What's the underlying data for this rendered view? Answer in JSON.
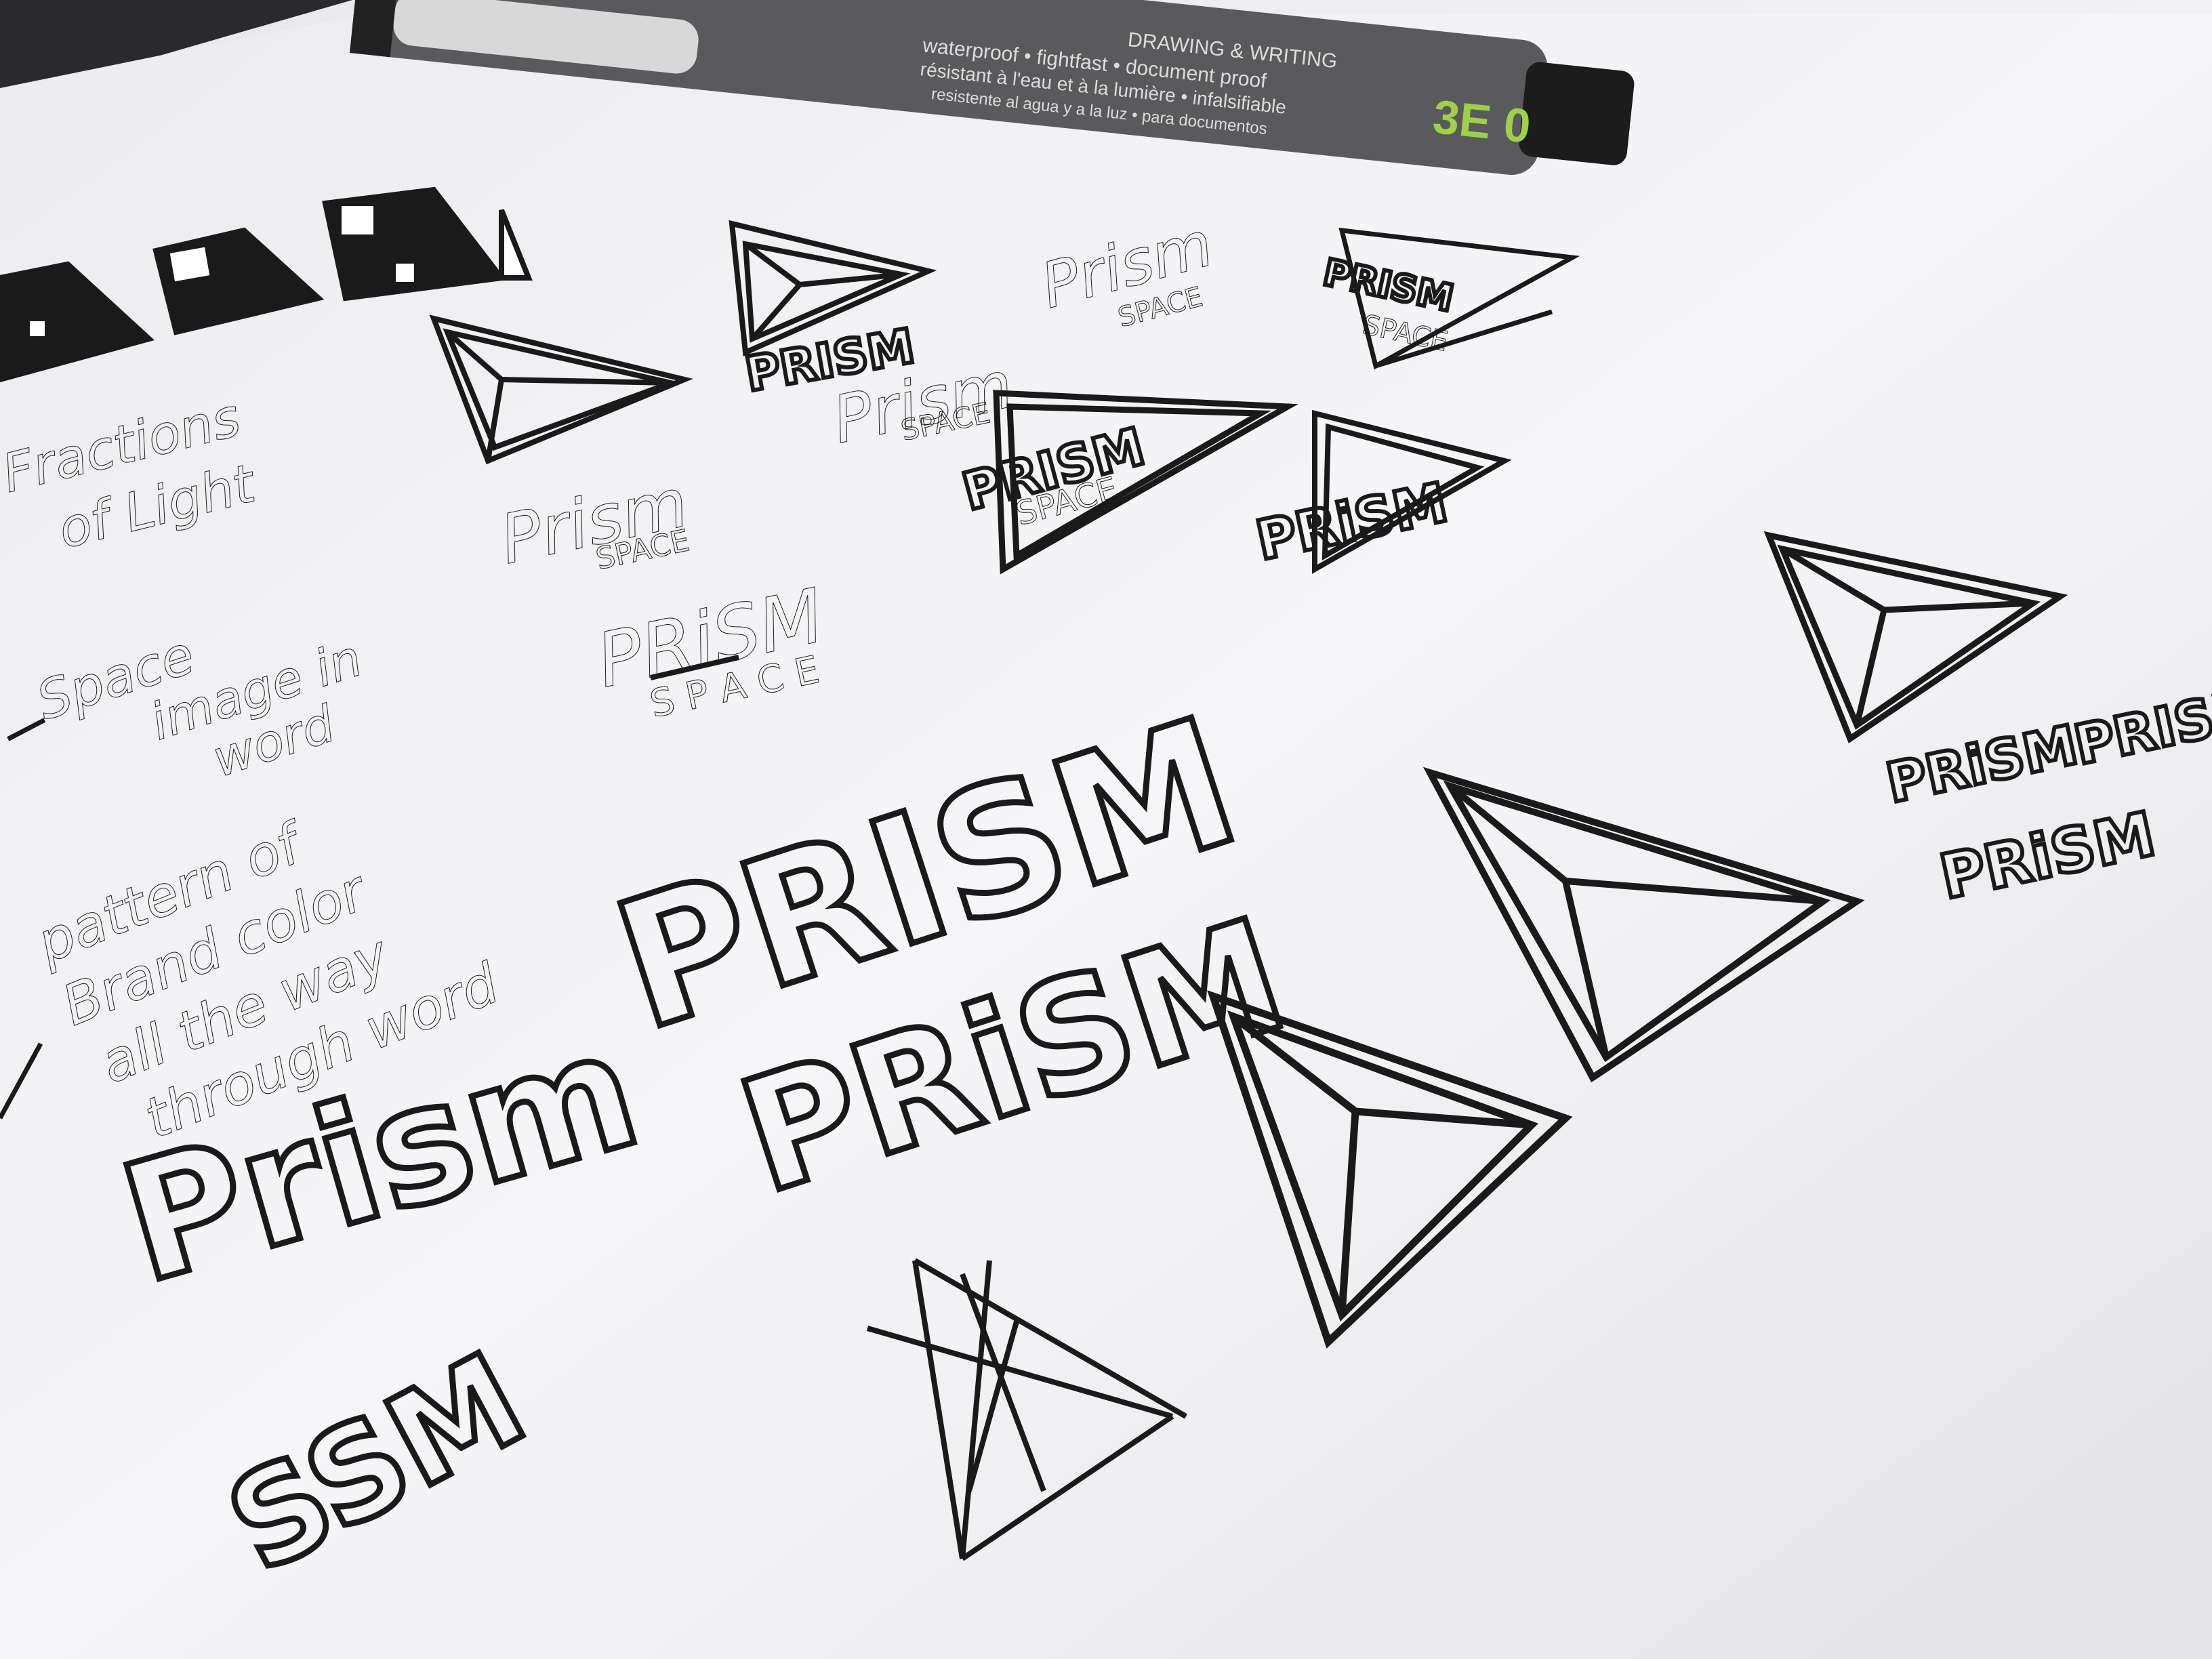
{
  "pen": {
    "line1": "DRAWING & WRITING",
    "line2": "waterproof • fightfast • document proof",
    "line3": "résistant à l'eau et à la lumière • infalsifiable",
    "line4": "resistente al agua y a la luz • para documentos",
    "size_mark": "3E 0",
    "body_color": "#5a5a5c",
    "accent_color": "#9fd04a"
  },
  "notes": {
    "note1": [
      "Fractions",
      "of Light"
    ],
    "note2": [
      "Space",
      "image in",
      "word"
    ],
    "note3": [
      "pattern of",
      "Brand color",
      "all the way",
      "through word"
    ]
  },
  "sketches": {
    "prism_word": "Prism",
    "prism_caps": "PRISM",
    "prism_caps_alt": "PRiSM",
    "space_word": "SPACE",
    "space_spaced": "S P A C E",
    "prism_space_strike": "SPACE",
    "prism_tail": "SSM",
    "prism_partial": "PRiSM"
  },
  "colors": {
    "ink": "#1a1a1a",
    "paper": "#f3f3f5"
  }
}
